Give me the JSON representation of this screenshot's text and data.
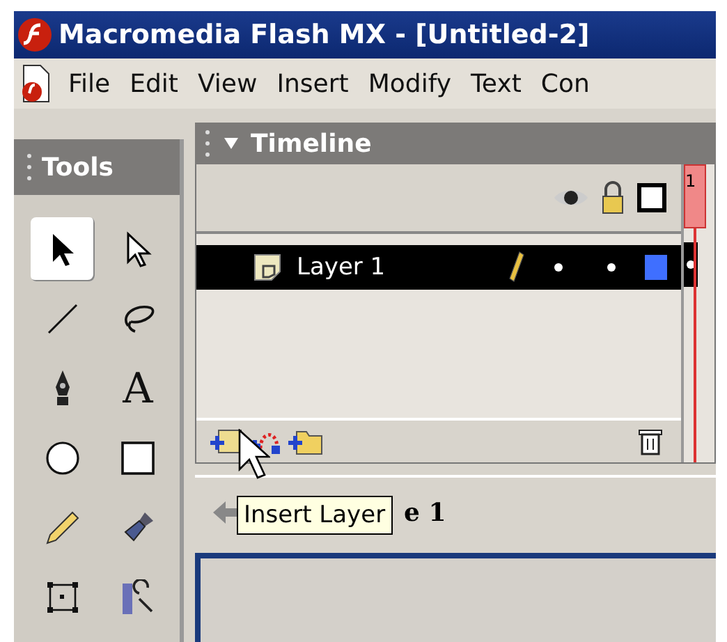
{
  "window": {
    "title": "Macromedia Flash MX - [Untitled-2]"
  },
  "menu": [
    "File",
    "Edit",
    "View",
    "Insert",
    "Modify",
    "Text",
    "Con"
  ],
  "tools": {
    "title": "Tools",
    "items": [
      {
        "kind": "arrow",
        "selected": true
      },
      {
        "kind": "subselect",
        "selected": false
      },
      {
        "kind": "line",
        "selected": false
      },
      {
        "kind": "lasso",
        "selected": false
      },
      {
        "kind": "pen",
        "selected": false
      },
      {
        "kind": "text",
        "label": "A",
        "selected": false
      },
      {
        "kind": "oval",
        "selected": false
      },
      {
        "kind": "rectangle",
        "selected": false
      },
      {
        "kind": "pencil",
        "selected": false
      },
      {
        "kind": "brush",
        "selected": false
      },
      {
        "kind": "transform",
        "selected": false
      },
      {
        "kind": "fill-transform",
        "selected": false
      }
    ]
  },
  "timeline": {
    "title": "Timeline",
    "expanded": true,
    "frame_number": "1",
    "layers": [
      {
        "name": "Layer 1",
        "selected": true,
        "color": "#3f6fff"
      }
    ]
  },
  "tooltip": "Insert Layer",
  "scene": {
    "label": "e 1"
  }
}
